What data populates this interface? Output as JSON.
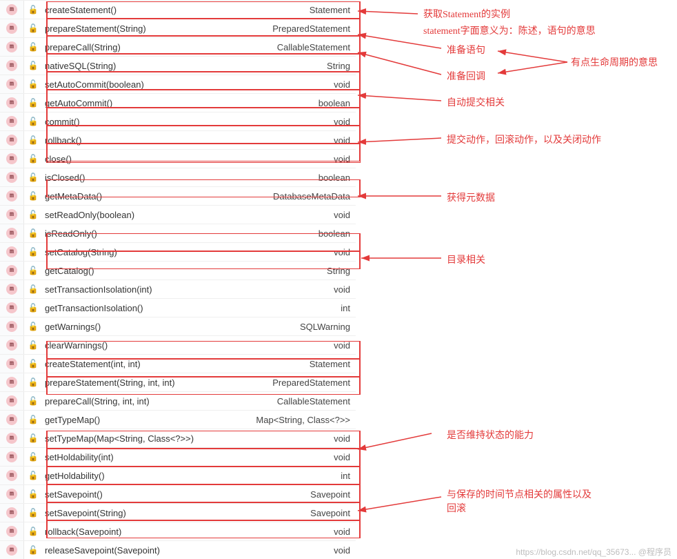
{
  "icons": {
    "method": "m",
    "lock": "🔓"
  },
  "rows": [
    {
      "sig": "createStatement()",
      "ret": "Statement",
      "boxed": true
    },
    {
      "sig": "prepareStatement(String)",
      "ret": "PreparedStatement",
      "boxed": true
    },
    {
      "sig": "prepareCall(String)",
      "ret": "CallableStatement",
      "boxed": true
    },
    {
      "sig": "nativeSQL(String)",
      "ret": "String",
      "boxed": true
    },
    {
      "sig": "setAutoCommit(boolean)",
      "ret": "void",
      "boxed": true
    },
    {
      "sig": "getAutoCommit()",
      "ret": "boolean",
      "boxed": true
    },
    {
      "sig": "commit()",
      "ret": "void",
      "boxed": true
    },
    {
      "sig": "rollback()",
      "ret": "void",
      "boxed": true
    },
    {
      "sig": "close()",
      "ret": "void",
      "boxed": true
    },
    {
      "sig": "isClosed()",
      "ret": "boolean",
      "boxed": false
    },
    {
      "sig": "getMetaData()",
      "ret": "DatabaseMetaData",
      "boxed": true
    },
    {
      "sig": "setReadOnly(boolean)",
      "ret": "void",
      "boxed": false
    },
    {
      "sig": "isReadOnly()",
      "ret": "boolean",
      "boxed": false
    },
    {
      "sig": "setCatalog(String)",
      "ret": "void",
      "boxed": true
    },
    {
      "sig": "getCatalog()",
      "ret": "String",
      "boxed": true
    },
    {
      "sig": "setTransactionIsolation(int)",
      "ret": "void",
      "boxed": false
    },
    {
      "sig": "getTransactionIsolation()",
      "ret": "int",
      "boxed": false
    },
    {
      "sig": "getWarnings()",
      "ret": "SQLWarning",
      "boxed": false
    },
    {
      "sig": "clearWarnings()",
      "ret": "void",
      "boxed": false
    },
    {
      "sig": "createStatement(int, int)",
      "ret": "Statement",
      "boxed": true
    },
    {
      "sig": "prepareStatement(String, int, int)",
      "ret": "PreparedStatement",
      "boxed": true
    },
    {
      "sig": "prepareCall(String, int, int)",
      "ret": "CallableStatement",
      "boxed": true
    },
    {
      "sig": "getTypeMap()",
      "ret": "Map<String, Class<?>>",
      "boxed": false
    },
    {
      "sig": "setTypeMap(Map<String, Class<?>>)",
      "ret": "void",
      "boxed": false
    },
    {
      "sig": "setHoldability(int)",
      "ret": "void",
      "boxed": true
    },
    {
      "sig": "getHoldability()",
      "ret": "int",
      "boxed": true
    },
    {
      "sig": "setSavepoint()",
      "ret": "Savepoint",
      "boxed": true
    },
    {
      "sig": "setSavepoint(String)",
      "ret": "Savepoint",
      "boxed": true
    },
    {
      "sig": "rollback(Savepoint)",
      "ret": "void",
      "boxed": true
    },
    {
      "sig": "releaseSavepoint(Savepoint)",
      "ret": "void",
      "boxed": true
    }
  ],
  "annotations": {
    "a1": "获取Statement的实例",
    "a2": "statement字面意义为：陈述，语句的意思",
    "a3": "准备语句",
    "a4": "准备回调",
    "a5": "有点生命周期的意思",
    "a6": "自动提交相关",
    "a7": "提交动作，回滚动作，以及关闭动作",
    "a8": "获得元数据",
    "a9": "目录相关",
    "a10": "是否维持状态的能力",
    "a11": "与保存的时间节点相关的属性以及",
    "a11b": "回滚"
  },
  "watermark": "https://blog.csdn.net/qq_35673...  @程序员"
}
